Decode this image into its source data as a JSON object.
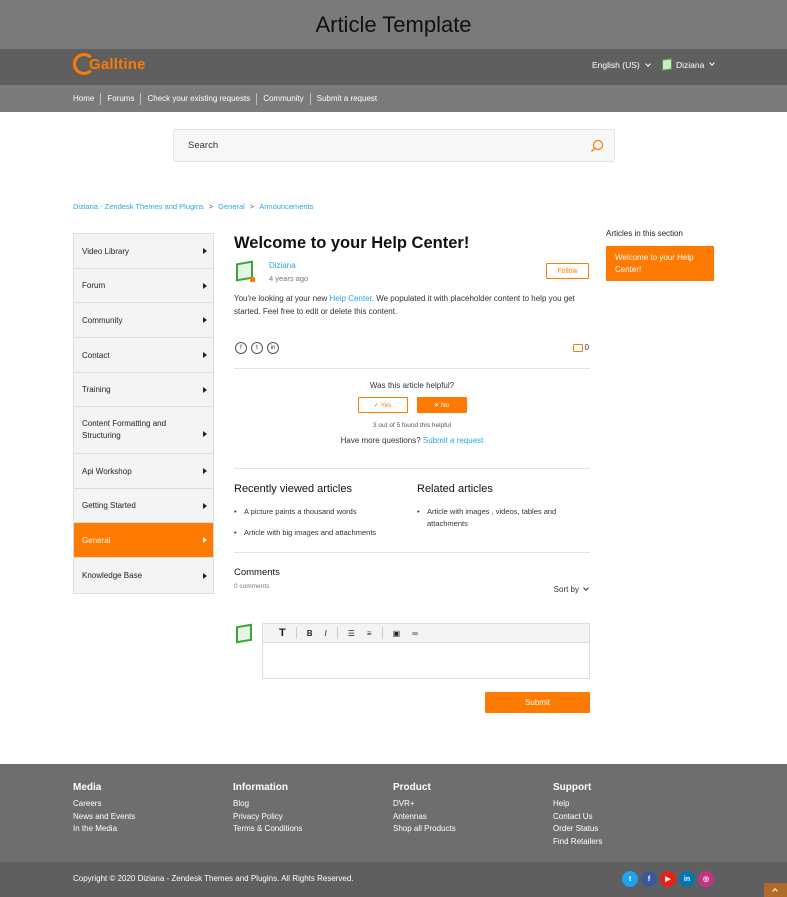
{
  "banner": {
    "title": "Article Template"
  },
  "header": {
    "logo_text": "Galltine",
    "language": "English (US)",
    "user_name": "Diziana"
  },
  "nav": [
    "Home",
    "Forums",
    "Check your existing requests",
    "Community",
    "Submit a request"
  ],
  "search": {
    "placeholder": "Search"
  },
  "breadcrumb": [
    "Diziana - Zendesk Themes and Plugins",
    "General",
    "Announcements"
  ],
  "sidebar": {
    "items": [
      {
        "label": "Video Library",
        "active": false
      },
      {
        "label": "Forum",
        "active": false
      },
      {
        "label": "Community",
        "active": false
      },
      {
        "label": "Contact",
        "active": false
      },
      {
        "label": "Training",
        "active": false
      },
      {
        "label": "Content Formatting and Structuring",
        "active": false
      },
      {
        "label": "Api Workshop",
        "active": false
      },
      {
        "label": "Getting Started",
        "active": false
      },
      {
        "label": "General",
        "active": true
      },
      {
        "label": "Knowledge Base",
        "active": false
      }
    ]
  },
  "article": {
    "title": "Welcome to your Help Center!",
    "author": "Diziana",
    "time": "4 years ago",
    "follow_label": "Follow",
    "body_before": "You're looking at your new ",
    "body_link": "Help Center",
    "body_after": ". We populated it with placeholder content to help you get started. Feel free to edit or delete this content.",
    "share_icons": [
      "facebook-icon",
      "twitter-icon",
      "linkedin-icon"
    ],
    "comment_count": "0"
  },
  "helpful": {
    "question": "Was this article helpful?",
    "yes_label": "✓  Yes",
    "no_label": "✕  No",
    "count_text": "3 out of 5 found this helpful",
    "more_text": "Have more questions?",
    "more_link": "Submit a request"
  },
  "recently_viewed": {
    "title": "Recently viewed articles",
    "items": [
      "A picture paints a thousand words",
      "Article with big images and attachments"
    ]
  },
  "related": {
    "title": "Related articles",
    "items": [
      "Article with images , videos, tables and attachments"
    ]
  },
  "comments": {
    "title": "Comments",
    "count": "0 comments",
    "sort_label": "Sort by",
    "toolbar": [
      "T",
      "B",
      "I",
      "bulleted-list-icon",
      "numbered-list-icon",
      "image-icon",
      "link-icon"
    ],
    "submit_label": "Submit"
  },
  "aside": {
    "title": "Articles in this section",
    "items": [
      "Welcome to your Help Center!"
    ]
  },
  "footer": {
    "columns": [
      {
        "title": "Media",
        "links": [
          "Careers",
          "News and Events",
          "In the Media"
        ]
      },
      {
        "title": "Information",
        "links": [
          "Blog",
          "Privacy Policy",
          "Terms & Conditions"
        ]
      },
      {
        "title": "Product",
        "links": [
          "DVR+",
          "Antennas",
          "Shop all Products"
        ]
      },
      {
        "title": "Support",
        "links": [
          "Help",
          "Contact Us",
          "Order Status",
          "Find Retailers"
        ]
      }
    ],
    "copyright": "Copyright © 2020 Diziana - Zendesk Themes and Plugins. All Rights Reserved.",
    "socials": [
      {
        "name": "twitter-icon",
        "glyph": "t",
        "color": "#1da1f2"
      },
      {
        "name": "facebook-icon",
        "glyph": "f",
        "color": "#3b5998"
      },
      {
        "name": "youtube-icon",
        "glyph": "▶",
        "color": "#e62117"
      },
      {
        "name": "linkedin-icon",
        "glyph": "in",
        "color": "#0077b5"
      },
      {
        "name": "instagram-icon",
        "glyph": "◎",
        "color": "#c13584"
      }
    ]
  },
  "colors": {
    "accent": "#ff7a00",
    "link": "#29a7e1",
    "header": "#5f5f5f",
    "footer": "#6e6e6e"
  }
}
